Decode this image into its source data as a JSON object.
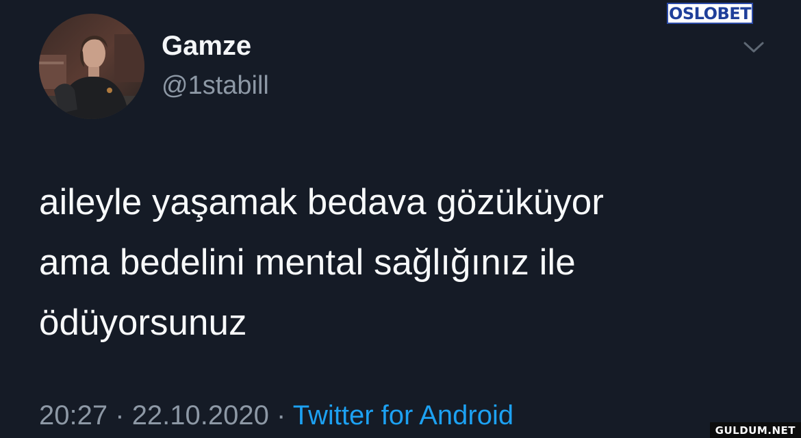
{
  "watermarks": {
    "top_logo": "OSLOBET",
    "bottom_site": "GULDUM.NET"
  },
  "tweet": {
    "author": {
      "display_name": "Gamze",
      "handle": "@1stabill",
      "avatar_icon": "profile-photo"
    },
    "menu_icon": "chevron-down-icon",
    "text": "aileyle yaşamak bedava gözüküyor\nama bedelini mental sağlığınız ile\nödüyorsunuz",
    "time": "20:27",
    "date": "22.10.2020",
    "separator": "·",
    "source": "Twitter for Android"
  },
  "colors": {
    "background": "#151b26",
    "primary_text": "#f7f9fa",
    "secondary_text": "#8d98a5",
    "link": "#1da1f2"
  }
}
